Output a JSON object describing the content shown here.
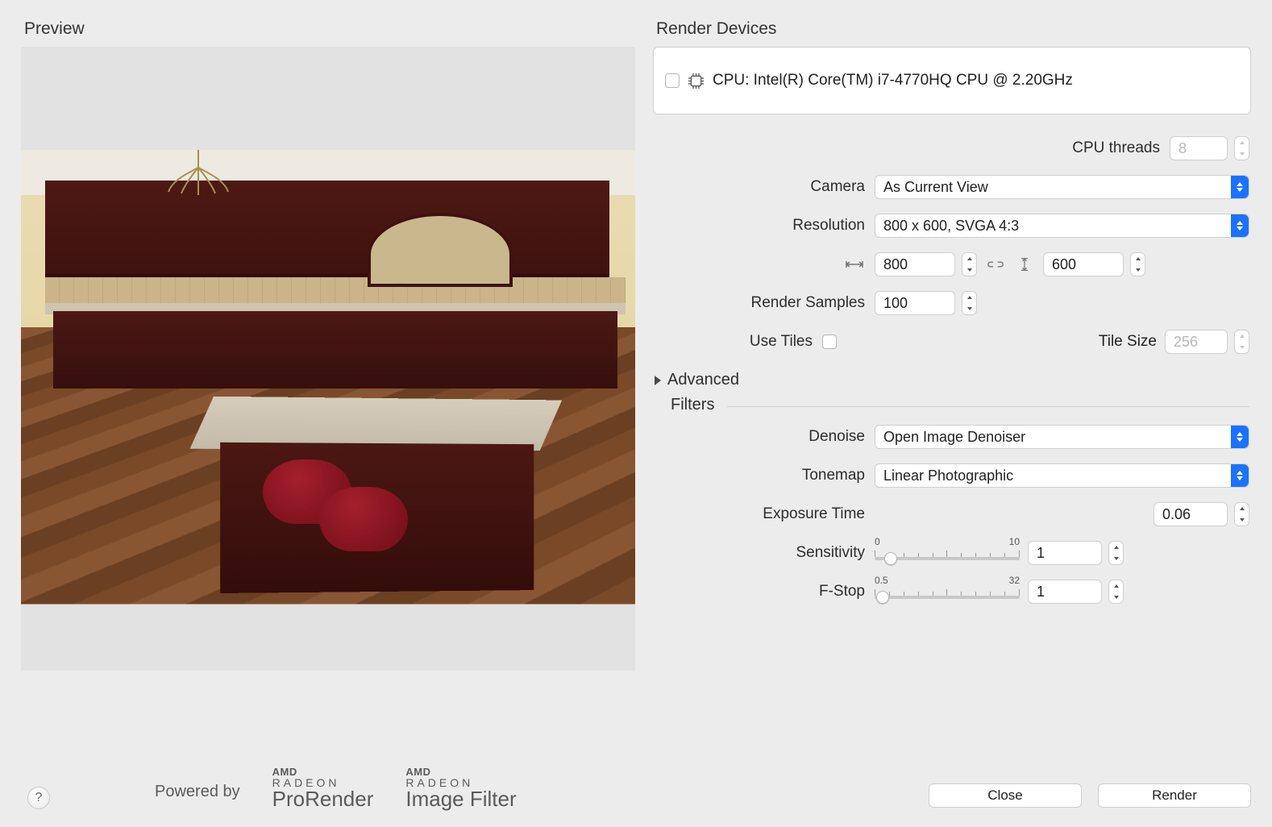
{
  "preview": {
    "title": "Preview"
  },
  "devices": {
    "title": "Render Devices",
    "cpu": "CPU: Intel(R) Core(TM) i7-4770HQ CPU @ 2.20GHz"
  },
  "threads": {
    "label": "CPU threads",
    "value": "8"
  },
  "camera": {
    "label": "Camera",
    "value": "As Current View"
  },
  "resolution": {
    "label": "Resolution",
    "value": "800 x 600, SVGA 4:3",
    "w": "800",
    "h": "600"
  },
  "samples": {
    "label": "Render Samples",
    "value": "100"
  },
  "tiles": {
    "label": "Use Tiles",
    "size_label": "Tile Size",
    "size": "256"
  },
  "advanced": "Advanced",
  "filters": "Filters",
  "denoise": {
    "label": "Denoise",
    "value": "Open Image Denoiser"
  },
  "tonemap": {
    "label": "Tonemap",
    "value": "Linear Photographic"
  },
  "exposure": {
    "label": "Exposure Time",
    "value": "0.06"
  },
  "sensitivity": {
    "label": "Sensitivity",
    "min": "0",
    "max": "10",
    "value": "1"
  },
  "fstop": {
    "label": "F-Stop",
    "min": "0.5",
    "max": "32",
    "value": "1"
  },
  "footer": {
    "powered": "Powered by",
    "amd": "AMD",
    "radeon": "RADEON",
    "p1": "ProRender",
    "p2": "Image Filter"
  },
  "buttons": {
    "close": "Close",
    "render": "Render"
  }
}
